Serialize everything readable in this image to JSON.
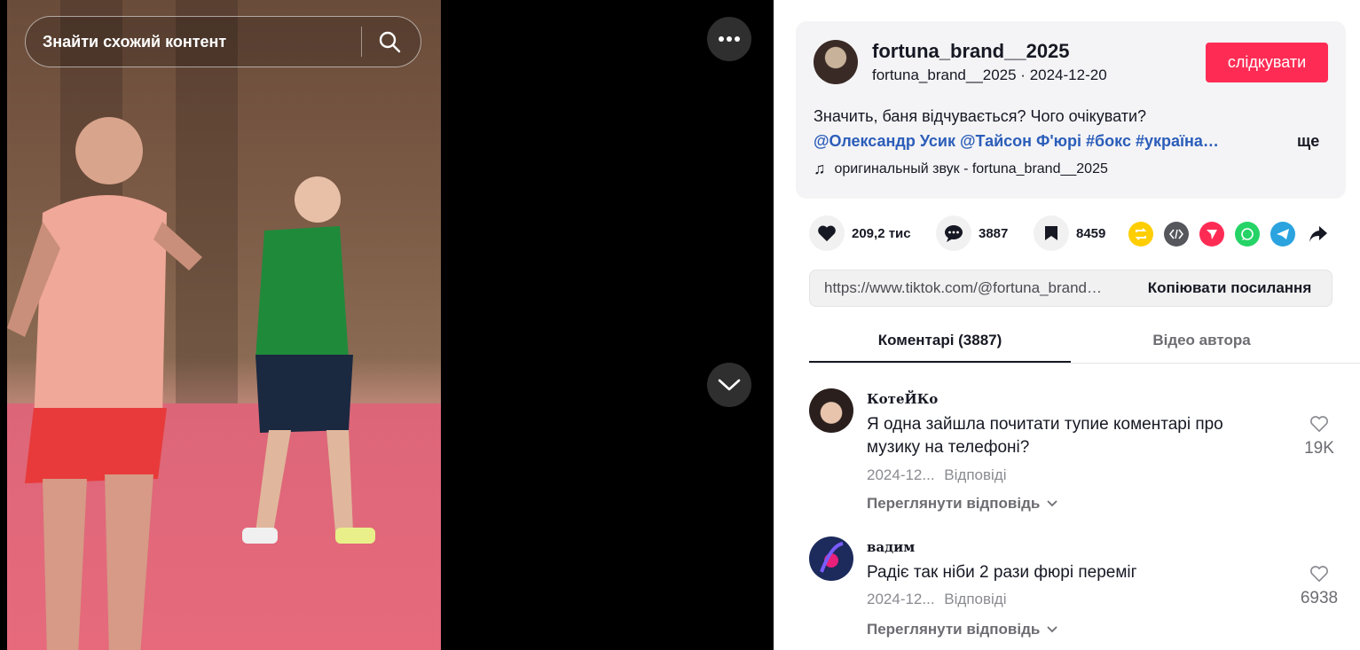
{
  "video": {
    "search_placeholder": "Знайти схожий контент"
  },
  "author": {
    "username": "fortuna_brand__2025",
    "handle": "fortuna_brand__2025",
    "date": "2024-12-20",
    "subline": "fortuna_brand__2025 · 2024-12-20",
    "follow_label": "слідкувати",
    "description": "Значить, баня відчувається? Чого очікувати?",
    "tags": "@Олександр Усик @Тайсон Ф'юрі #бокс #україна…",
    "more_label": "ще",
    "sound": "оригинальный звук - fortuna_brand__2025"
  },
  "actions": {
    "likes": "209,2 тис",
    "comments": "3887",
    "saves": "8459"
  },
  "share": {
    "url": "https://www.tiktok.com/@fortuna_brand…",
    "copy_label": "Копіювати посилання"
  },
  "tabs": {
    "comments": "Коментарі (3887)",
    "videos": "Відео автора"
  },
  "comments": [
    {
      "user": "КотеЙКо",
      "text": "Я одна зайшла почитати тупие коментарі про музику на телефоні?",
      "date": "2024-12...",
      "reply_label": "Відповіді",
      "likes": "19K",
      "view_replies": "Переглянути відповідь"
    },
    {
      "user": "вадим",
      "text": "Радіє так ніби 2 рази фюрі переміг",
      "date": "2024-12...",
      "reply_label": "Відповіді",
      "likes": "6938",
      "view_replies": "Переглянути відповідь"
    }
  ],
  "colors": {
    "accent": "#fe2c55",
    "tag_link": "#2b5db9"
  }
}
